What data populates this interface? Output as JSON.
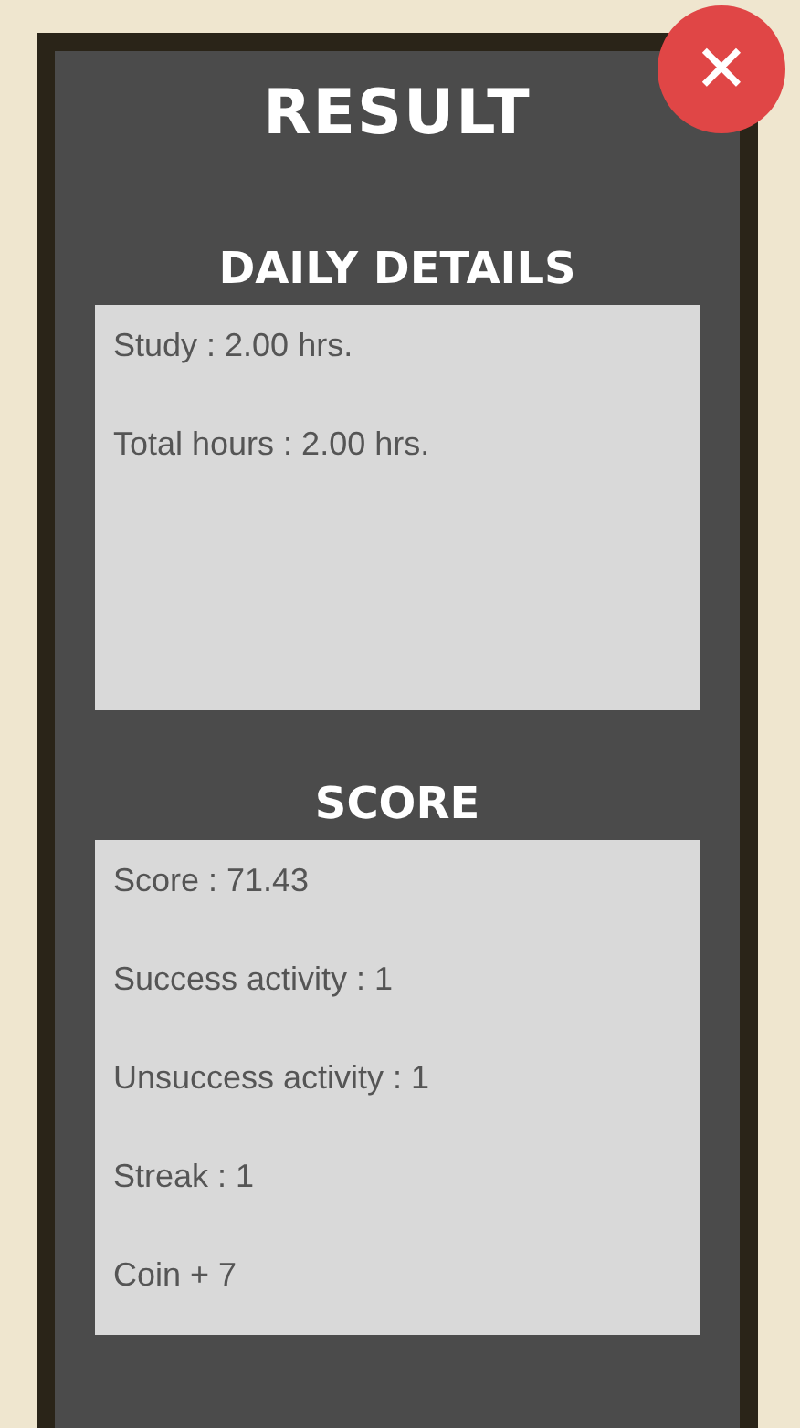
{
  "title": "RESULT",
  "close_button": "✕",
  "sections": [
    {
      "heading": "DAILY DETAILS",
      "lines": [
        "Study : 2.00 hrs.",
        "Total hours : 2.00 hrs."
      ]
    },
    {
      "heading": "SCORE",
      "lines": [
        "Score : 71.43",
        "Success activity : 1",
        "Unsuccess activity : 1",
        "Streak : 1",
        "Coin + 7"
      ]
    }
  ]
}
